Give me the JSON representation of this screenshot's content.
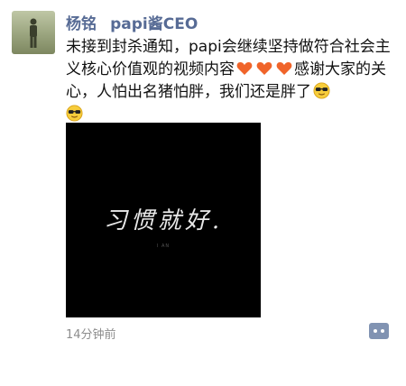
{
  "post": {
    "author_name": "杨铭",
    "shared_name": "papi酱CEO",
    "text_segments": [
      "未接到封杀通知，papi会继续坚持做符合社会主义核心价值观的视频内容",
      "感谢大家的关心，人怕出名猪怕胖，我们还是胖了"
    ],
    "emojis": [
      "heart-icon",
      "heart-icon",
      "heart-icon",
      "cool-face-icon",
      "cool-face-icon"
    ],
    "image_caption": "习惯就好.",
    "image_subtext": "I AN",
    "time_ago": "14分钟前",
    "colors": {
      "name": "#576b95",
      "heart": "#f0642a",
      "comment_button": "#8193b2",
      "timestamp": "#8d8d8d"
    }
  }
}
